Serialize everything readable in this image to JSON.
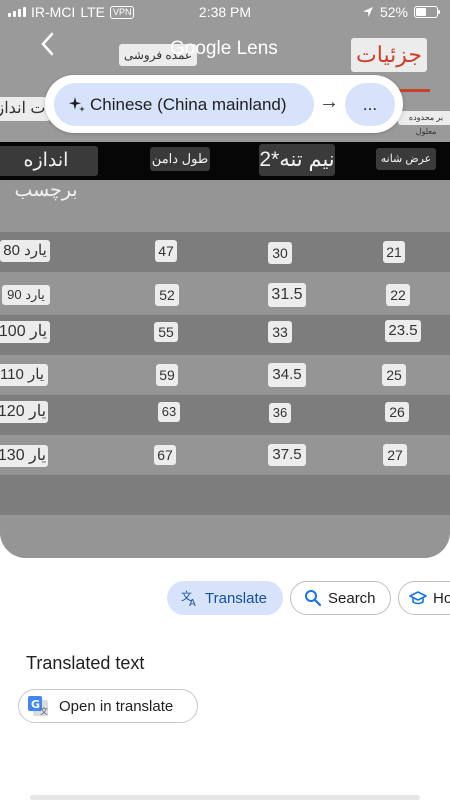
{
  "status_bar": {
    "carrier": "IR-MCI",
    "network": "LTE",
    "vpn": "VPN",
    "time": "2:38 PM",
    "battery": "52%"
  },
  "header": {
    "title_word1": "Google",
    "title_word2": "Lens"
  },
  "image_text": {
    "top_left_chip": "عمده فروشی",
    "top_right_chip": "جزئیات",
    "left_cut_chip": "ت انداز",
    "small_right_chip": "بر محدوده معلول"
  },
  "language": {
    "source": "Chinese (China mainland)",
    "arrow": "→",
    "target": "..."
  },
  "table": {
    "headers": [
      "اندازه برچسب",
      "طول دامن",
      "نیم تنه*2",
      "عرض شانه"
    ],
    "rows": [
      [
        "80 یارد",
        "47",
        "30",
        "21"
      ],
      [
        "90 یارد",
        "52",
        "31.5",
        "22"
      ],
      [
        "100 یار",
        "55",
        "33",
        "23.5"
      ],
      [
        "110 یار",
        "59",
        "34.5",
        "25"
      ],
      [
        "120 یار",
        "63",
        "36",
        "26"
      ],
      [
        "130 یار",
        "67",
        "37.5",
        "27"
      ]
    ]
  },
  "actions": {
    "translate": "Translate",
    "search": "Search",
    "homework": "Ho"
  },
  "translated_section": {
    "title": "Translated text",
    "open_button": "Open in translate"
  },
  "colors": {
    "accent": "#d6e3fb",
    "accent_text": "#174ea6",
    "red_text": "#c9412a"
  }
}
